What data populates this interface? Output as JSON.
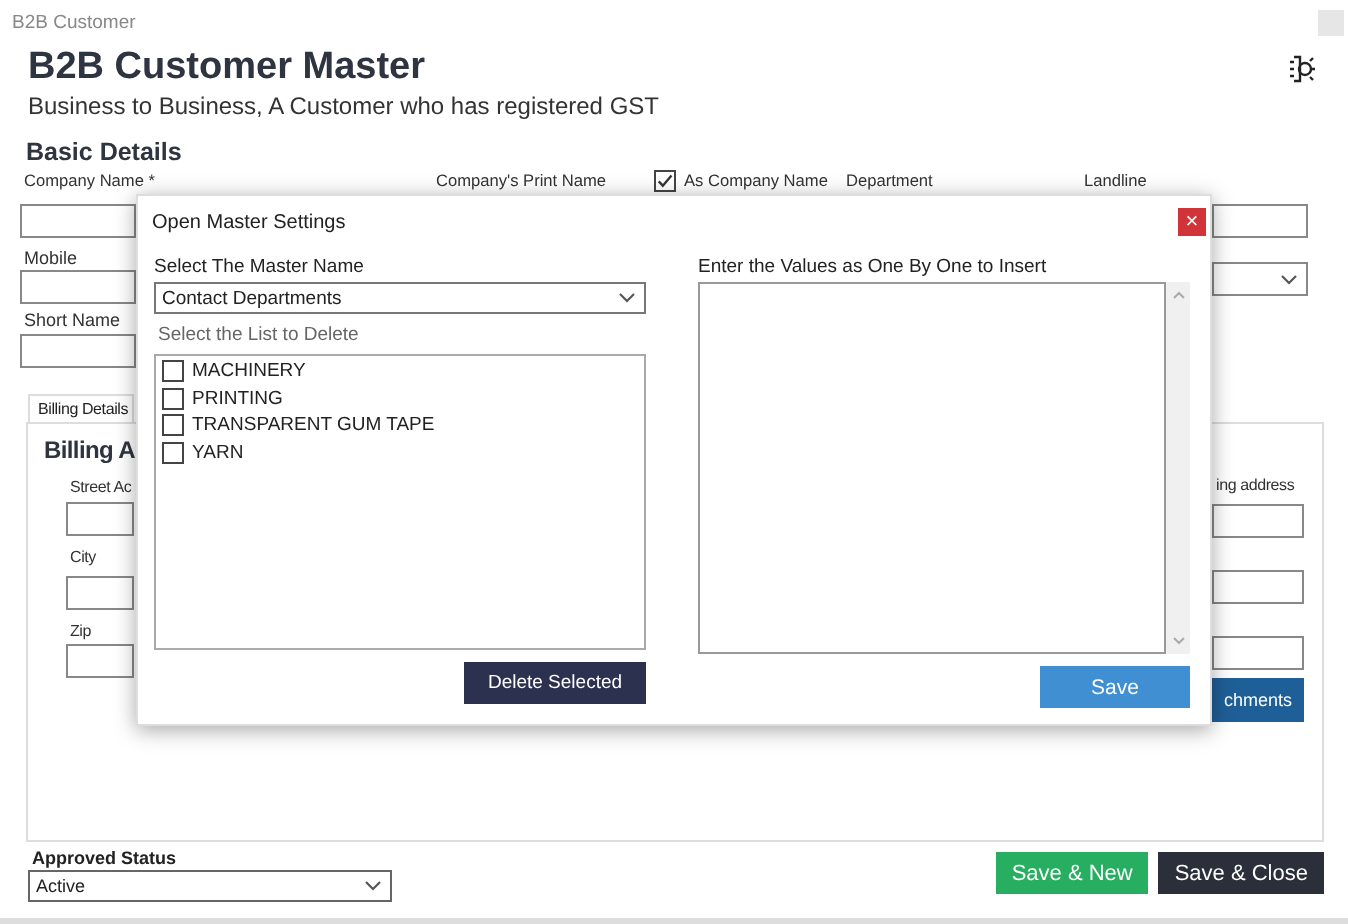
{
  "window": {
    "title": "B2B Customer"
  },
  "header": {
    "title": "B2B Customer Master",
    "subtitle": "Business to Business, A Customer who has registered GST"
  },
  "basic_details": {
    "heading": "Basic Details",
    "company_name_label": "Company Name *",
    "print_name_label": "Company's Print Name",
    "as_company_name": {
      "label": "As Company Name",
      "checked": true
    },
    "department_label": "Department",
    "landline_label": "Landline",
    "mobile_label": "Mobile",
    "short_name_label": "Short Name"
  },
  "tabs": [
    {
      "label": "Billing Details",
      "selected": true
    }
  ],
  "billing": {
    "heading": "Billing A",
    "street_label": "Street Ac",
    "city_label": "City",
    "zip_label": "Zip",
    "column_2_label": "ing address",
    "column_2_button": "chments"
  },
  "approved_status": {
    "label": "Approved Status",
    "value": "Active"
  },
  "buttons": [
    {
      "label": "Save & New",
      "kind": "success"
    },
    {
      "label": "Save & Close",
      "kind": "dark"
    }
  ],
  "dialog": {
    "title": "Open Master Settings",
    "close": "×",
    "master_label": "Select The Master Name",
    "master_value": "Contact Departments",
    "list_label": "Select the List to Delete",
    "items": [
      {
        "label": "MACHINERY",
        "checked": false
      },
      {
        "label": "PRINTING",
        "checked": false
      },
      {
        "label": "TRANSPARENT GUM TAPE",
        "checked": false
      },
      {
        "label": "YARN",
        "checked": false
      }
    ],
    "delete_button": "Delete Selected",
    "values_label": "Enter the Values as One By One to Insert",
    "save_button": "Save"
  }
}
